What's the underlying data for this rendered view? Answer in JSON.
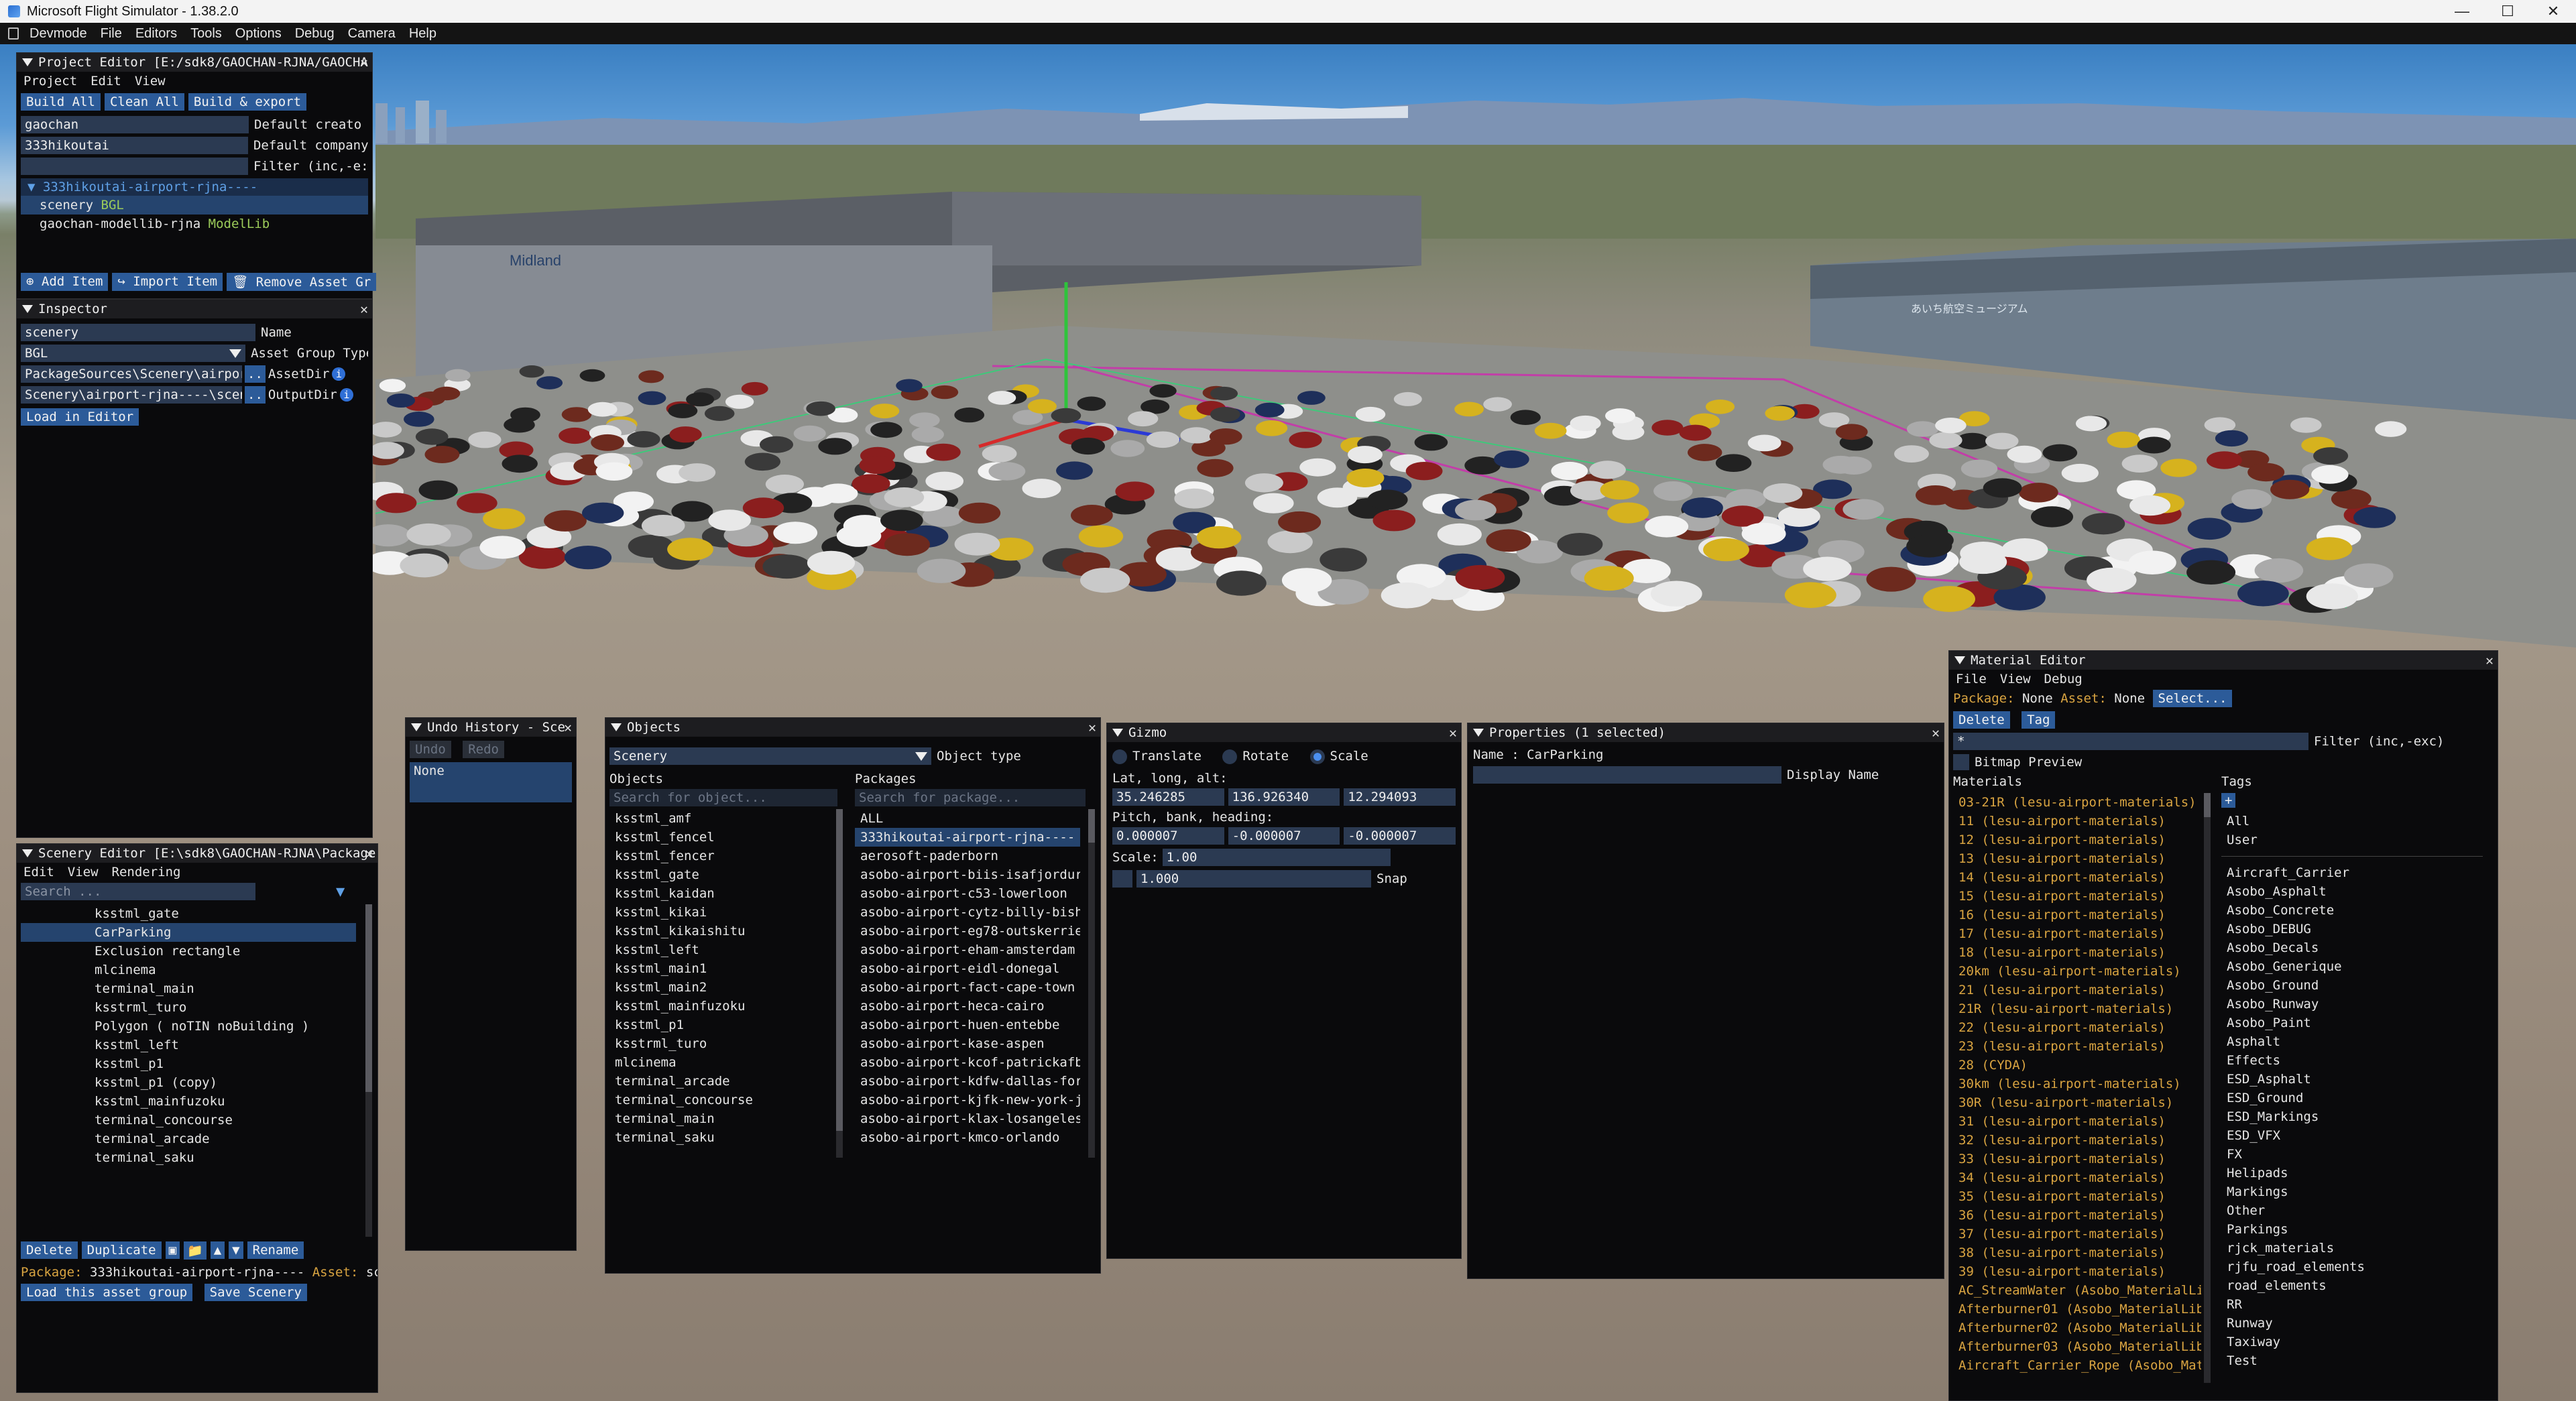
{
  "window": {
    "title": "Microsoft Flight Simulator - 1.38.2.0"
  },
  "menubar": [
    "Devmode",
    "File",
    "Editors",
    "Tools",
    "Options",
    "Debug",
    "Camera",
    "Help"
  ],
  "project_editor": {
    "title": "Project Editor [E:/sdk8/GAOCHAN-RJNA/GAOCHA",
    "menu": [
      "Project",
      "Edit",
      "View"
    ],
    "buttons": [
      "Build All",
      "Clean All",
      "Build & export"
    ],
    "fields": [
      {
        "value": "gaochan",
        "label": "Default creato"
      },
      {
        "value": "333hikoutai",
        "label": "Default company"
      },
      {
        "value": "",
        "label": "Filter (inc,-e:"
      }
    ],
    "tree": {
      "root": "333hikoutai-airport-rjna----",
      "items": [
        {
          "name": "scenery",
          "tag": "BGL"
        },
        {
          "name": "gaochan-modellib-rjna",
          "tag": "ModelLib"
        }
      ]
    },
    "actions": [
      "Add Item",
      "Import Item",
      "Remove Asset Gr"
    ]
  },
  "inspector": {
    "title": "Inspector",
    "fields": [
      {
        "value": "scenery",
        "label": "Name"
      },
      {
        "value": "BGL",
        "label": "Asset Group Type"
      },
      {
        "value": "PackageSources\\Scenery\\airport-",
        "label": "AssetDir"
      },
      {
        "value": "Scenery\\airport-rjna----\\scener",
        "label": "OutputDir"
      }
    ],
    "browse": "..",
    "load_button": "Load in Editor"
  },
  "scenery_editor": {
    "title": "Scenery Editor [E:\\sdk8\\GAOCHAN-RJNA\\Package",
    "menu": [
      "Edit",
      "View",
      "Rendering"
    ],
    "search_placeholder": "Search ...",
    "items": [
      "ksstml_gate",
      "CarParking",
      "Exclusion rectangle",
      "mlcinema",
      "terminal_main",
      "ksstrml_turo",
      "Polygon  ( noTIN noBuilding )",
      "ksstml_left",
      "ksstml_p1",
      "ksstml_p1 (copy)",
      "ksstml_mainfuzoku",
      "terminal_concourse",
      "terminal_arcade",
      "terminal_saku"
    ],
    "selected": "CarParking",
    "buttons": [
      "Delete",
      "Duplicate",
      "Rename"
    ],
    "package_label": "Package:",
    "package_value": "333hikoutai-airport-rjna----",
    "asset_label": "Asset:",
    "asset_value": "sc",
    "bottom_buttons": [
      "Load this asset group",
      "Save Scenery"
    ]
  },
  "undo_history": {
    "title": "Undo History - Sce",
    "undo": "Undo",
    "redo": "Redo",
    "items": [
      "None"
    ]
  },
  "objects": {
    "title": "Objects",
    "type_value": "Scenery",
    "type_label": "Object type",
    "objects_header": "Objects",
    "packages_header": "Packages",
    "object_search": "Search for object...",
    "package_search": "Search for package...",
    "object_list": [
      "ksstml_amf",
      "ksstml_fencel",
      "ksstml_fencer",
      "ksstml_gate",
      "ksstml_kaidan",
      "ksstml_kikai",
      "ksstml_kikaishitu",
      "ksstml_left",
      "ksstml_main1",
      "ksstml_main2",
      "ksstml_mainfuzoku",
      "ksstml_p1",
      "ksstrml_turo",
      "mlcinema",
      "terminal_arcade",
      "terminal_concourse",
      "terminal_main",
      "terminal_saku"
    ],
    "package_list": [
      "ALL",
      "333hikoutai-airport-rjna----",
      "aerosoft-paderborn",
      "asobo-airport-biis-isafjordur",
      "asobo-airport-c53-lowerloon",
      "asobo-airport-cytz-billy-bisho",
      "asobo-airport-eg78-outskerries",
      "asobo-airport-eham-amsterdam",
      "asobo-airport-eidl-donegal",
      "asobo-airport-fact-cape-town",
      "asobo-airport-heca-cairo",
      "asobo-airport-huen-entebbe",
      "asobo-airport-kase-aspen",
      "asobo-airport-kcof-patrickafb",
      "asobo-airport-kdfw-dallas-fort",
      "asobo-airport-kjfk-new-york-jf",
      "asobo-airport-klax-losangeles",
      "asobo-airport-kmco-orlando"
    ],
    "selected_package": "333hikoutai-airport-rjna----"
  },
  "gizmo": {
    "title": "Gizmo",
    "modes": [
      "Translate",
      "Rotate",
      "Scale"
    ],
    "active_mode": "Scale",
    "lla_label": "Lat, long, alt:",
    "lla": [
      "35.246285",
      "136.926340",
      "12.294093"
    ],
    "pbh_label": "Pitch, bank, heading:",
    "pbh": [
      "0.000007",
      "-0.000007",
      "-0.000007"
    ],
    "scale_label": "Scale:",
    "scale_value": "1.00",
    "snap_value": "1.000",
    "snap_label": "Snap"
  },
  "properties": {
    "title": "Properties (1 selected)",
    "name_line": "Name : CarParking",
    "display_name_label": "Display Name"
  },
  "material_editor": {
    "title": "Material Editor",
    "menu": [
      "File",
      "View",
      "Debug"
    ],
    "package_label": "Package:",
    "package_value": "None",
    "asset_label": "Asset:",
    "asset_value": "None",
    "select_button": "Select...",
    "buttons": [
      "Delete",
      "Tag"
    ],
    "filter_value": "*",
    "filter_label": "Filter (inc,-exc)",
    "bitmap_preview": "Bitmap Preview",
    "materials_header": "Materials",
    "tags_header": "Tags",
    "add_tag": "+",
    "materials": [
      "03-21R (lesu-airport-materials)",
      "11 (lesu-airport-materials)",
      "12 (lesu-airport-materials)",
      "13 (lesu-airport-materials)",
      "14 (lesu-airport-materials)",
      "15 (lesu-airport-materials)",
      "16 (lesu-airport-materials)",
      "17 (lesu-airport-materials)",
      "18 (lesu-airport-materials)",
      "20km (lesu-airport-materials)",
      "21 (lesu-airport-materials)",
      "21R (lesu-airport-materials)",
      "22 (lesu-airport-materials)",
      "23 (lesu-airport-materials)",
      "28 (CYDA)",
      "30km (lesu-airport-materials)",
      "30R (lesu-airport-materials)",
      "31 (lesu-airport-materials)",
      "32 (lesu-airport-materials)",
      "33 (lesu-airport-materials)",
      "34 (lesu-airport-materials)",
      "35 (lesu-airport-materials)",
      "36 (lesu-airport-materials)",
      "37 (lesu-airport-materials)",
      "38 (lesu-airport-materials)",
      "39 (lesu-airport-materials)",
      "AC_StreamWater (Asobo_MaterialLib",
      "Afterburner01 (Asobo_MaterialLib)",
      "Afterburner02 (Asobo_MaterialLib)",
      "Afterburner03 (Asobo_MaterialLib)",
      "Aircraft_Carrier_Rope (Asobo_Mate"
    ],
    "tags_top": [
      "All",
      "User"
    ],
    "tags": [
      "Aircraft_Carrier",
      "Asobo_Asphalt",
      "Asobo_Concrete",
      "Asobo_DEBUG",
      "Asobo_Decals",
      "Asobo_Generique",
      "Asobo_Ground",
      "Asobo_Runway",
      "Asobo_Paint",
      "Asphalt",
      "Effects",
      "ESD_Asphalt",
      "ESD_Ground",
      "ESD_Markings",
      "ESD_VFX",
      "FX",
      "Helipads",
      "Markings",
      "Other",
      "Parkings",
      "rjck_materials",
      "rjfu_road_elements",
      "road_elements",
      "RR",
      "Runway",
      "Taxiway",
      "Test"
    ]
  },
  "viewport": {
    "signs": [
      "Midland",
      "あいち航空ミュージアム"
    ]
  }
}
